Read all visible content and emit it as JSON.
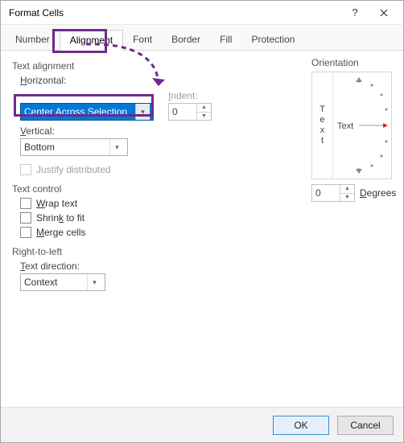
{
  "dialog": {
    "title": "Format Cells"
  },
  "tabs": {
    "number": "Number",
    "alignment": "Alignment",
    "font": "Font",
    "border": "Border",
    "fill": "Fill",
    "protection": "Protection",
    "active": "Alignment"
  },
  "text_alignment": {
    "section": "Text alignment",
    "horizontal_label": "Horizontal:",
    "horizontal_value": "Center Across Selection",
    "indent_label": "Indent:",
    "indent_value": "0",
    "vertical_label": "Vertical:",
    "vertical_value": "Bottom",
    "justify_label": "Justify distributed"
  },
  "text_control": {
    "section": "Text control",
    "wrap": "Wrap text",
    "shrink": "Shrink to fit",
    "merge": "Merge cells"
  },
  "rtl": {
    "section": "Right-to-left",
    "dir_label": "Text direction:",
    "dir_value": "Context"
  },
  "orientation": {
    "section": "Orientation",
    "vtext": "T\ne\nx\nt",
    "htext": "Text",
    "degrees_value": "0",
    "degrees_label": "Degrees"
  },
  "buttons": {
    "ok": "OK",
    "cancel": "Cancel"
  },
  "icons": {
    "help": "?",
    "close": "✕"
  }
}
